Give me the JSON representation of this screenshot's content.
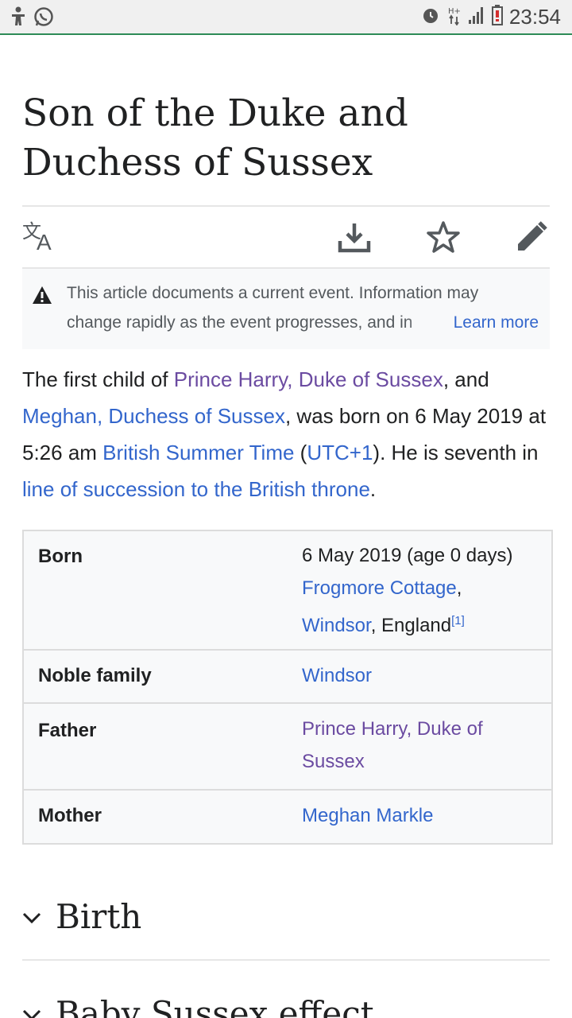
{
  "status_bar": {
    "time": "23:54",
    "icons_left": [
      "accessibility-icon",
      "whatsapp-icon"
    ],
    "icons_right": [
      "alarm-icon",
      "network-hplus-icon",
      "signal-icon",
      "battery-low-icon"
    ]
  },
  "article": {
    "title": "Son of the Duke and Duchess of Sussex"
  },
  "toolbar": {
    "icons": [
      "translate-icon",
      "download-icon",
      "star-icon",
      "edit-icon"
    ]
  },
  "notice": {
    "text_line1": "This article documents a current event. Information may",
    "text_line2": "change rapidly as the event progresses, and in",
    "learn_more": "Learn more"
  },
  "intro": {
    "t1": "The first child of ",
    "l1": "Prince Harry, Duke of Sussex",
    "t2": ", and ",
    "l2": "Meghan, Duchess of Sussex",
    "t3": ", was born on 6 May 2019 at 5:26 am ",
    "l3": "British Summer Time",
    "t4": " (",
    "l4": "UTC+1",
    "t5": "). He is seventh in ",
    "l5": "line of succession to the British throne",
    "t6": "."
  },
  "infobox": {
    "born_label": "Born",
    "born_date": "6 May 2019 (age 0 days)",
    "born_place1": "Frogmore Cottage",
    "born_comma": ",",
    "born_place2": "Windsor",
    "born_country": ", England",
    "born_ref": "[1]",
    "family_label": "Noble family",
    "family_value": "Windsor",
    "father_label": "Father",
    "father_value": "Prince Harry, Duke of Sussex",
    "mother_label": "Mother",
    "mother_value": "Meghan Markle"
  },
  "sections": [
    {
      "title": "Birth"
    },
    {
      "title": "Baby Sussex effect"
    }
  ]
}
